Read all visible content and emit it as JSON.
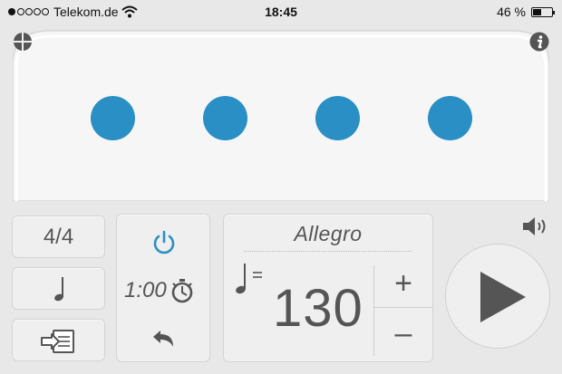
{
  "status_bar": {
    "carrier": "Telekom.de",
    "time": "18:45",
    "battery": "46 %",
    "battery_level": 0.46
  },
  "beats": {
    "count": 4,
    "color": "#2a8fc4"
  },
  "controls": {
    "time_signature": "4/4",
    "timer_value": "1:00",
    "power_color": "#2a8fc4"
  },
  "tempo": {
    "name": "Allegro",
    "bpm": "130",
    "plus_label": "+",
    "minus_label": "–"
  },
  "icons": {
    "top_left": "globe-icon",
    "top_right": "info-icon",
    "note": "quarter-note-icon",
    "import": "import-file-icon",
    "power": "power-icon",
    "stopwatch": "stopwatch-icon",
    "undo": "undo-icon",
    "volume": "speaker-icon",
    "play": "play-icon"
  }
}
